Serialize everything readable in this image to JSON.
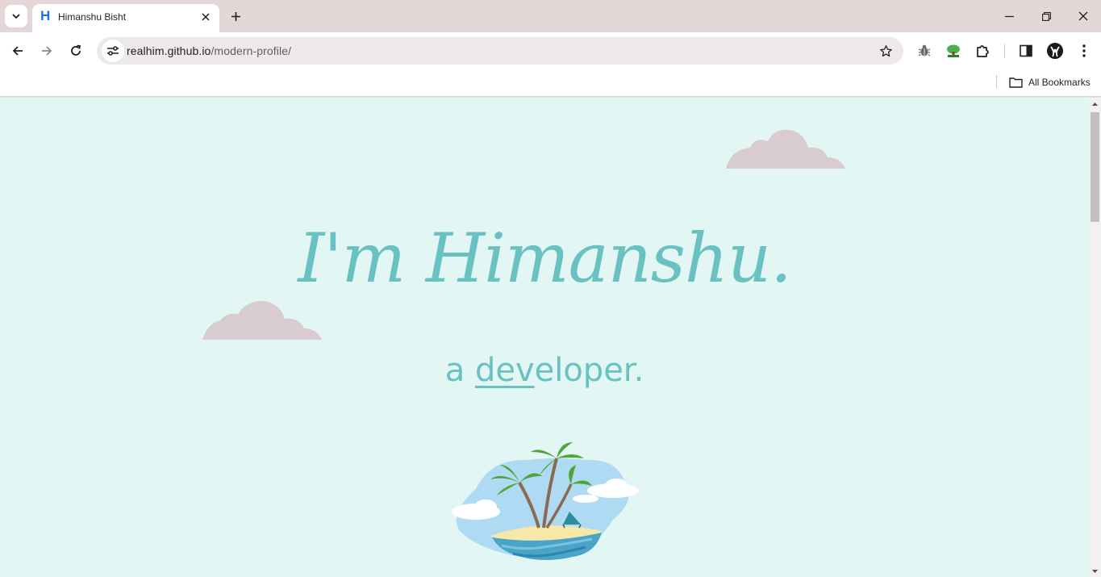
{
  "browser": {
    "tab": {
      "favicon_letter": "H",
      "title": "Himanshu Bisht"
    },
    "address_bar": {
      "host": "realhim.github.io",
      "path": "/modern-profile/"
    },
    "bookmarks_bar": {
      "all_bookmarks_label": "All Bookmarks"
    },
    "icons": {
      "tab_search": "chevron-down-icon",
      "close_tab": "close-icon",
      "new_tab": "plus-icon",
      "minimize": "minimize-icon",
      "restore": "restore-icon",
      "close_window": "close-icon",
      "back": "arrow-left-icon",
      "forward": "arrow-right-icon",
      "reload": "reload-icon",
      "site_info": "tune-icon",
      "bookmark_star": "star-icon",
      "extension_bug": "bug-icon",
      "extension_tree": "tree-icon",
      "extensions": "puzzle-icon",
      "side_panel": "side-panel-icon",
      "profile": "avatar-icon",
      "menu": "more-vert-icon",
      "bookmarks_folder": "folder-icon"
    }
  },
  "page": {
    "hero": {
      "greeting": "I'm Himanshu.",
      "prefix": "a",
      "role_typed": "dev",
      "role_rest": "eloper."
    },
    "colors": {
      "background": "#e2f6f4",
      "accent": "#69c1c2",
      "cloud": "#d8ccd1"
    }
  }
}
